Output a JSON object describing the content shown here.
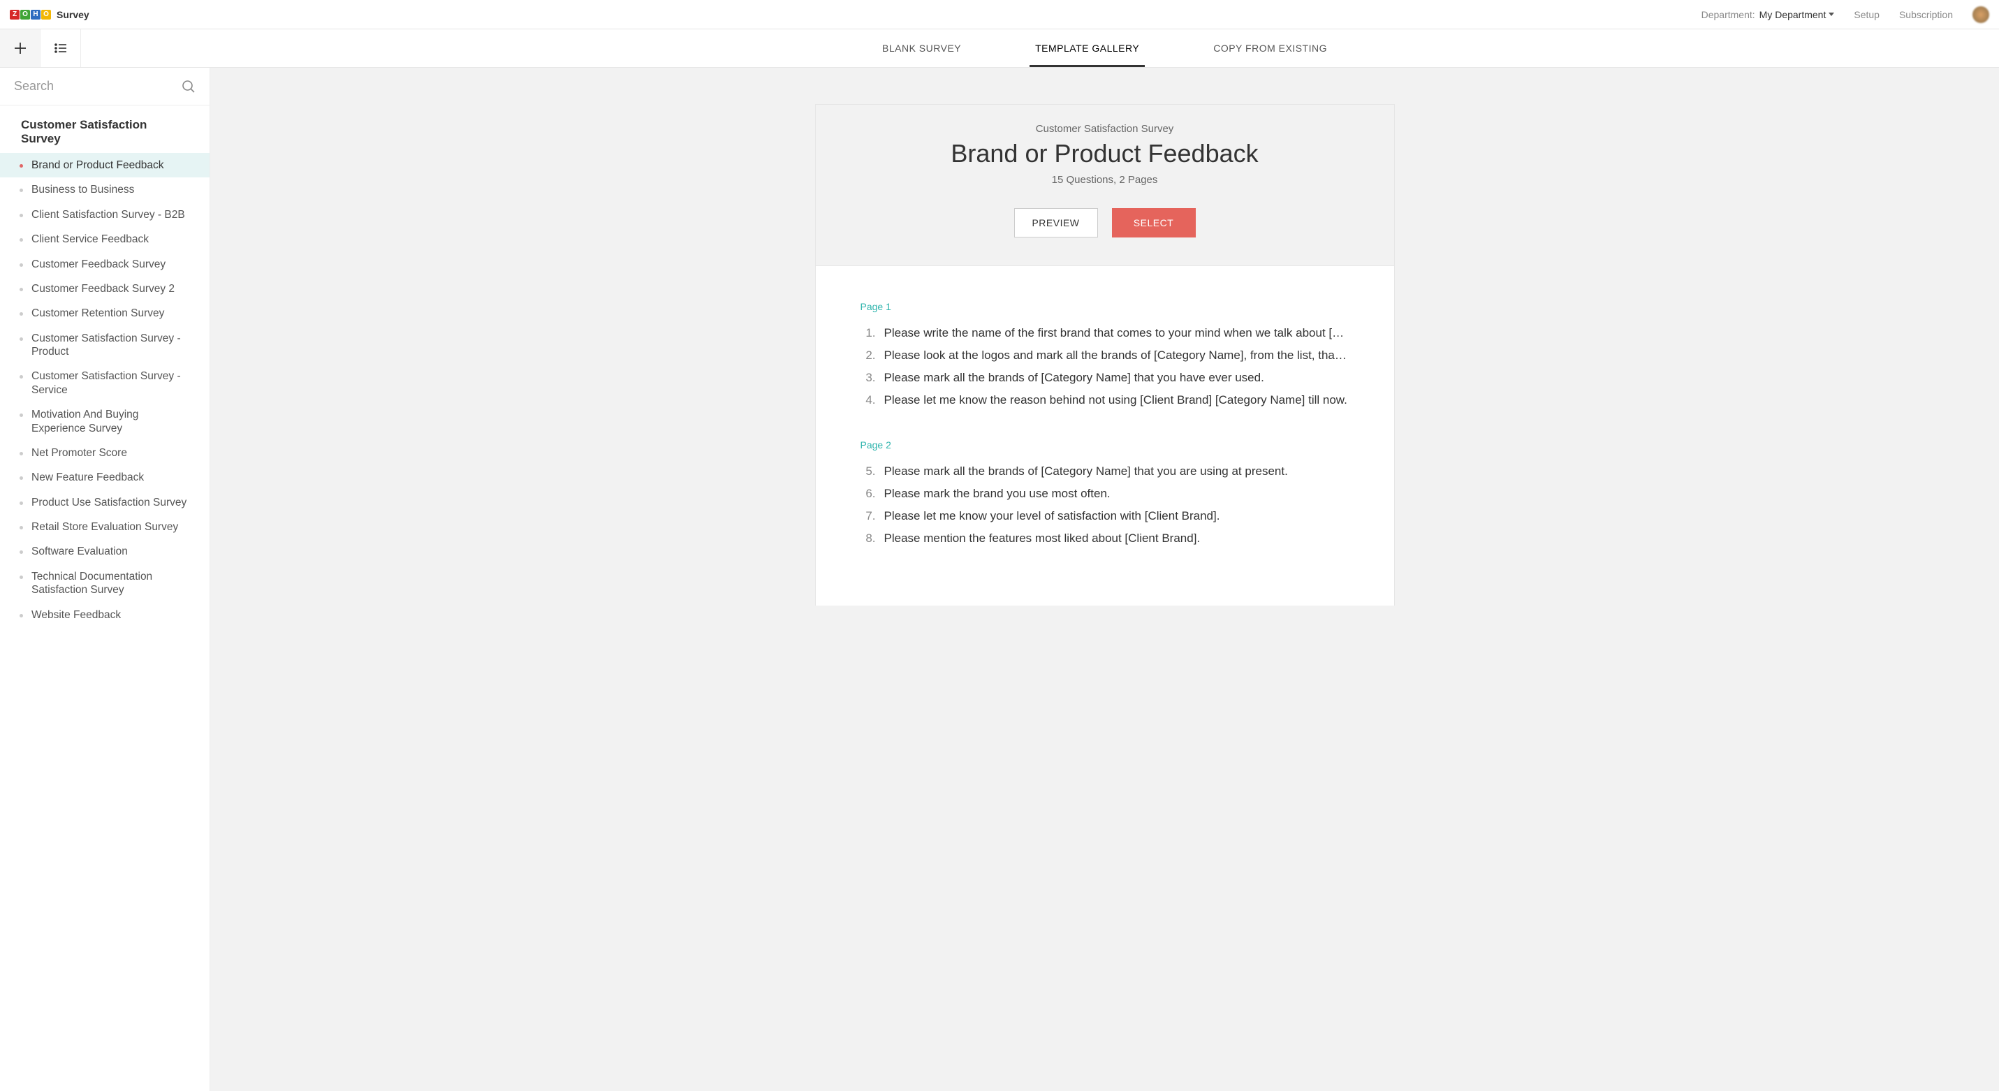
{
  "brand": {
    "name": "Survey"
  },
  "header": {
    "department_label": "Department:",
    "department_value": "My Department",
    "links": {
      "setup": "Setup",
      "subscription": "Subscription"
    }
  },
  "tabs": {
    "blank": "BLANK SURVEY",
    "gallery": "TEMPLATE GALLERY",
    "copy": "COPY FROM EXISTING"
  },
  "search": {
    "placeholder": "Search"
  },
  "sidebar": {
    "category": "Customer Satisfaction Survey",
    "items": [
      {
        "label": "Brand or Product Feedback",
        "active": true
      },
      {
        "label": "Business to Business"
      },
      {
        "label": "Client Satisfaction Survey - B2B"
      },
      {
        "label": "Client Service Feedback"
      },
      {
        "label": "Customer Feedback Survey"
      },
      {
        "label": "Customer Feedback Survey 2"
      },
      {
        "label": "Customer Retention Survey"
      },
      {
        "label": "Customer Satisfaction Survey - Product"
      },
      {
        "label": "Customer Satisfaction Survey - Service"
      },
      {
        "label": "Motivation And Buying Experience Survey"
      },
      {
        "label": "Net Promoter Score"
      },
      {
        "label": "New Feature Feedback"
      },
      {
        "label": "Product Use Satisfaction Survey"
      },
      {
        "label": "Retail Store Evaluation Survey"
      },
      {
        "label": "Software Evaluation"
      },
      {
        "label": "Technical Documentation Satisfaction Survey"
      },
      {
        "label": "Website Feedback"
      }
    ]
  },
  "preview": {
    "category": "Customer Satisfaction Survey",
    "title": "Brand or Product Feedback",
    "meta": "15 Questions, 2 Pages",
    "preview_btn": "PREVIEW",
    "select_btn": "SELECT",
    "pages": [
      {
        "label": "Page 1",
        "start": 1,
        "questions": [
          "Please write the name of the first brand that comes to your mind when we talk about [Category Name].",
          "Please look at the logos and mark all the brands of [Category Name], from the list, that you recognize.",
          "Please mark all the brands of [Category Name] that you have ever used.",
          "Please let me know the reason behind not using [Client Brand] [Category Name] till now."
        ]
      },
      {
        "label": "Page 2",
        "start": 5,
        "questions": [
          "Please mark all the brands of [Category Name] that you are using at present.",
          "Please mark the brand you use most often.",
          "Please let me know your level of satisfaction with [Client Brand].",
          "Please mention the features most liked about [Client Brand]."
        ]
      }
    ]
  }
}
